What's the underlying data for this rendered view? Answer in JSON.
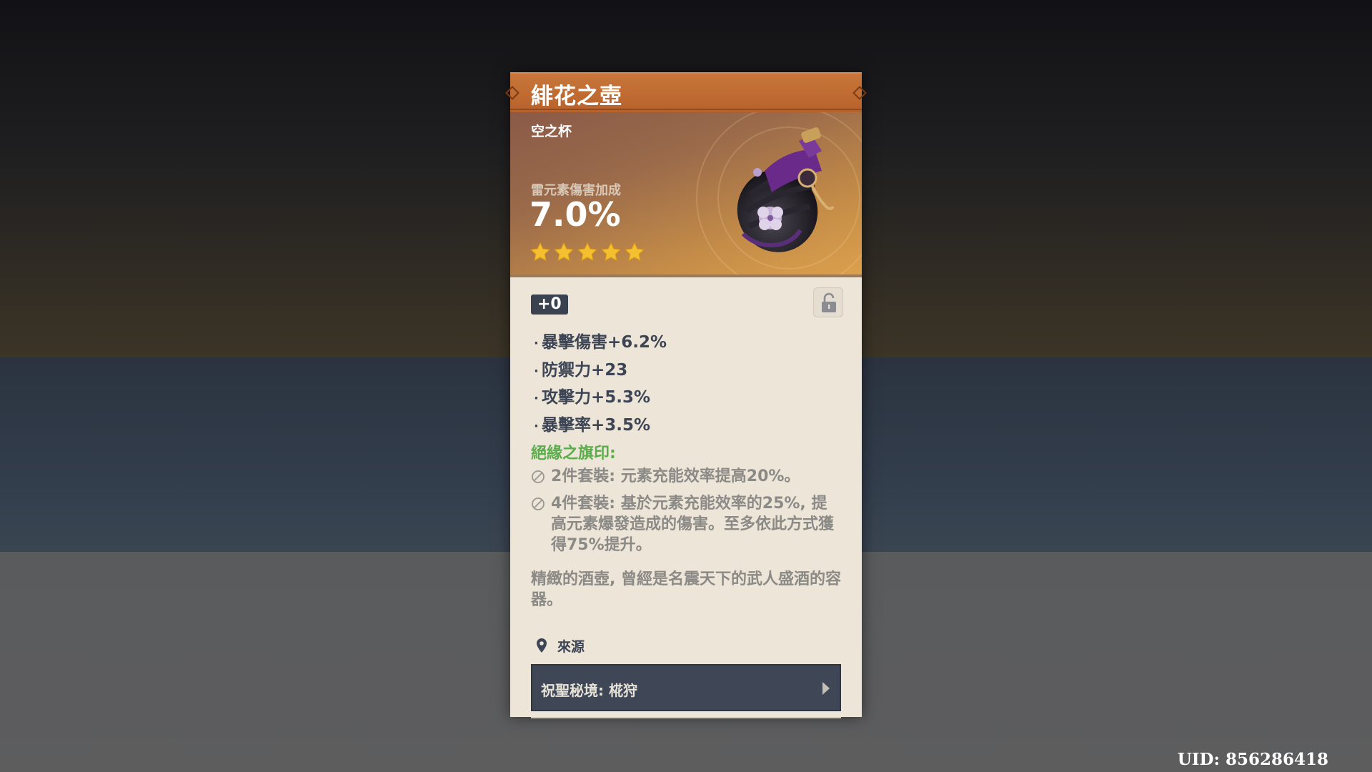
{
  "artifact": {
    "name": "緋花之壺",
    "type": "空之杯",
    "main_stat_label": "雷元素傷害加成",
    "main_stat_value": "7.0%",
    "rarity": 5,
    "level": "+0",
    "locked": false,
    "substats": [
      "暴擊傷害+6.2%",
      "防禦力+23",
      "攻擊力+5.3%",
      "暴擊率+3.5%"
    ],
    "set_name": "絕緣之旗印:",
    "set_bonuses": [
      {
        "text": "2件套裝: 元素充能效率提高20%。",
        "icon": "disabled-circle-icon"
      },
      {
        "text": "4件套裝: 基於元素充能效率的25%, 提高元素爆發造成的傷害。至多依此方式獲得75%提升。",
        "icon": "disabled-circle-icon"
      }
    ],
    "description": "精緻的酒壺, 曾經是名震天下的武人盛酒的容器。",
    "source_label": "來源",
    "source_item": "祝聖秘境: 椛狩"
  },
  "uid_text": "UID: 856286418",
  "colors": {
    "header_orange": "#c8763a",
    "card_bg": "#ece5d8",
    "set_green": "#5aad4a",
    "star_gold": "#f5c030",
    "badge_dark": "#3a4250",
    "text_dark": "#3d4555",
    "text_gray": "#8c8a86"
  },
  "icons": {
    "lock": "unlocked-padlock-icon",
    "source": "location-pin-icon",
    "arrow": "chevron-right-icon",
    "star": "star-icon"
  }
}
